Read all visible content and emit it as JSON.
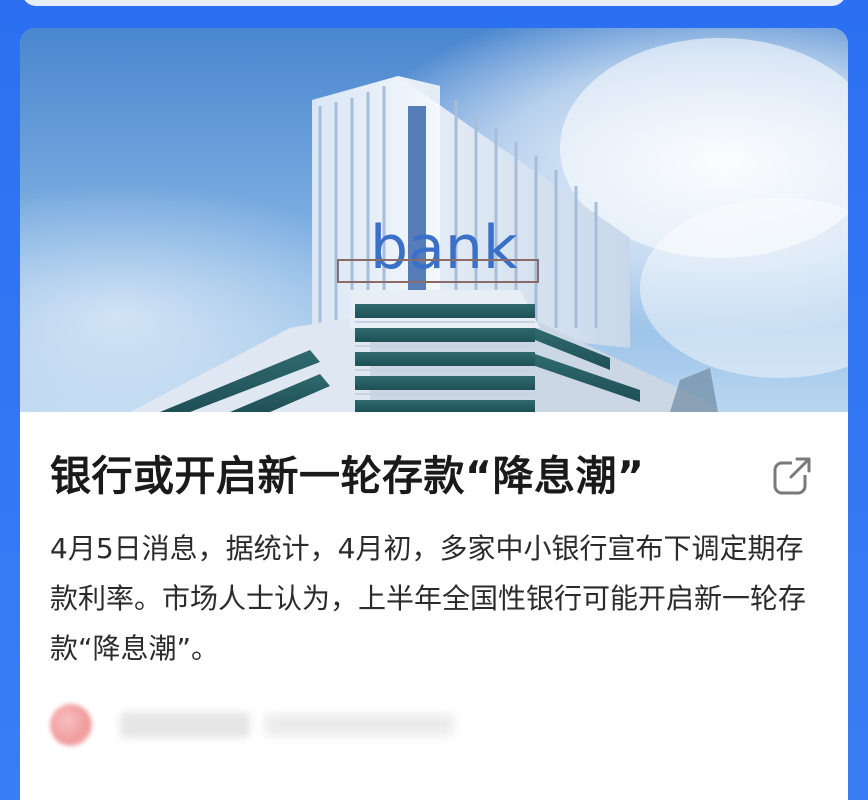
{
  "article": {
    "image_alt_sign": "bank",
    "headline": "银行或开启新一轮存款“降息潮”",
    "summary": "4月5日消息，据统计，4月初，多家中小银行宣布下调定期存款利率。市场人士认为，上半年全国性银行可能开启新一轮存款“降息潮”。",
    "share_icon": "share-icon"
  },
  "colors": {
    "background": "#2f73f0",
    "card": "#ffffff",
    "headline": "#1a1a1a",
    "body_text": "#2b2b2b",
    "icon": "#7a7a7a"
  }
}
